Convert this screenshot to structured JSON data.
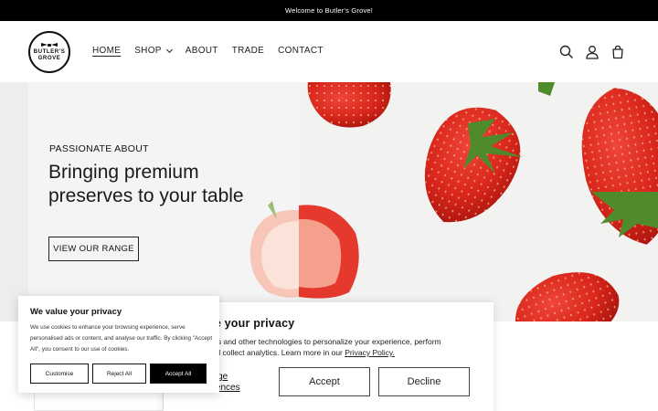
{
  "announcement": "Welcome to Butler's Grove!",
  "logo": {
    "line1": "BUTLER'S",
    "line2": "GROVE"
  },
  "nav": [
    {
      "label": "HOME",
      "active": true
    },
    {
      "label": "SHOP",
      "dropdown": true
    },
    {
      "label": "ABOUT"
    },
    {
      "label": "TRADE"
    },
    {
      "label": "CONTACT"
    }
  ],
  "header_icons": [
    "search-icon",
    "account-icon",
    "cart-icon"
  ],
  "hero": {
    "kicker": "PASSIONATE ABOUT",
    "headline": "Bringing premium preserves to your table",
    "cta": "VIEW OUR RANGE"
  },
  "privacy_modal": {
    "title": "ue your privacy",
    "body_prefix": "kies and other technologies to personalize your experience, perform",
    "body_line2": "and collect analytics. Learn more in our",
    "link": "Privacy Policy.",
    "manage_line1": "nage",
    "manage_line2": "erences",
    "accept": "Accept",
    "decline": "Decline"
  },
  "cookie_popup": {
    "title": "We value your privacy",
    "body": "We use cookies to enhance your browsing experience, serve personalised ads or content, and analyse our traffic. By clicking \"Accept All\", you consent to our use of cookies.",
    "customise": "Customise",
    "reject": "Reject All",
    "accept": "Accept All"
  },
  "colors": {
    "strawberry": "#d9261c",
    "leaf": "#4f8a2b",
    "dark": "#000000"
  }
}
